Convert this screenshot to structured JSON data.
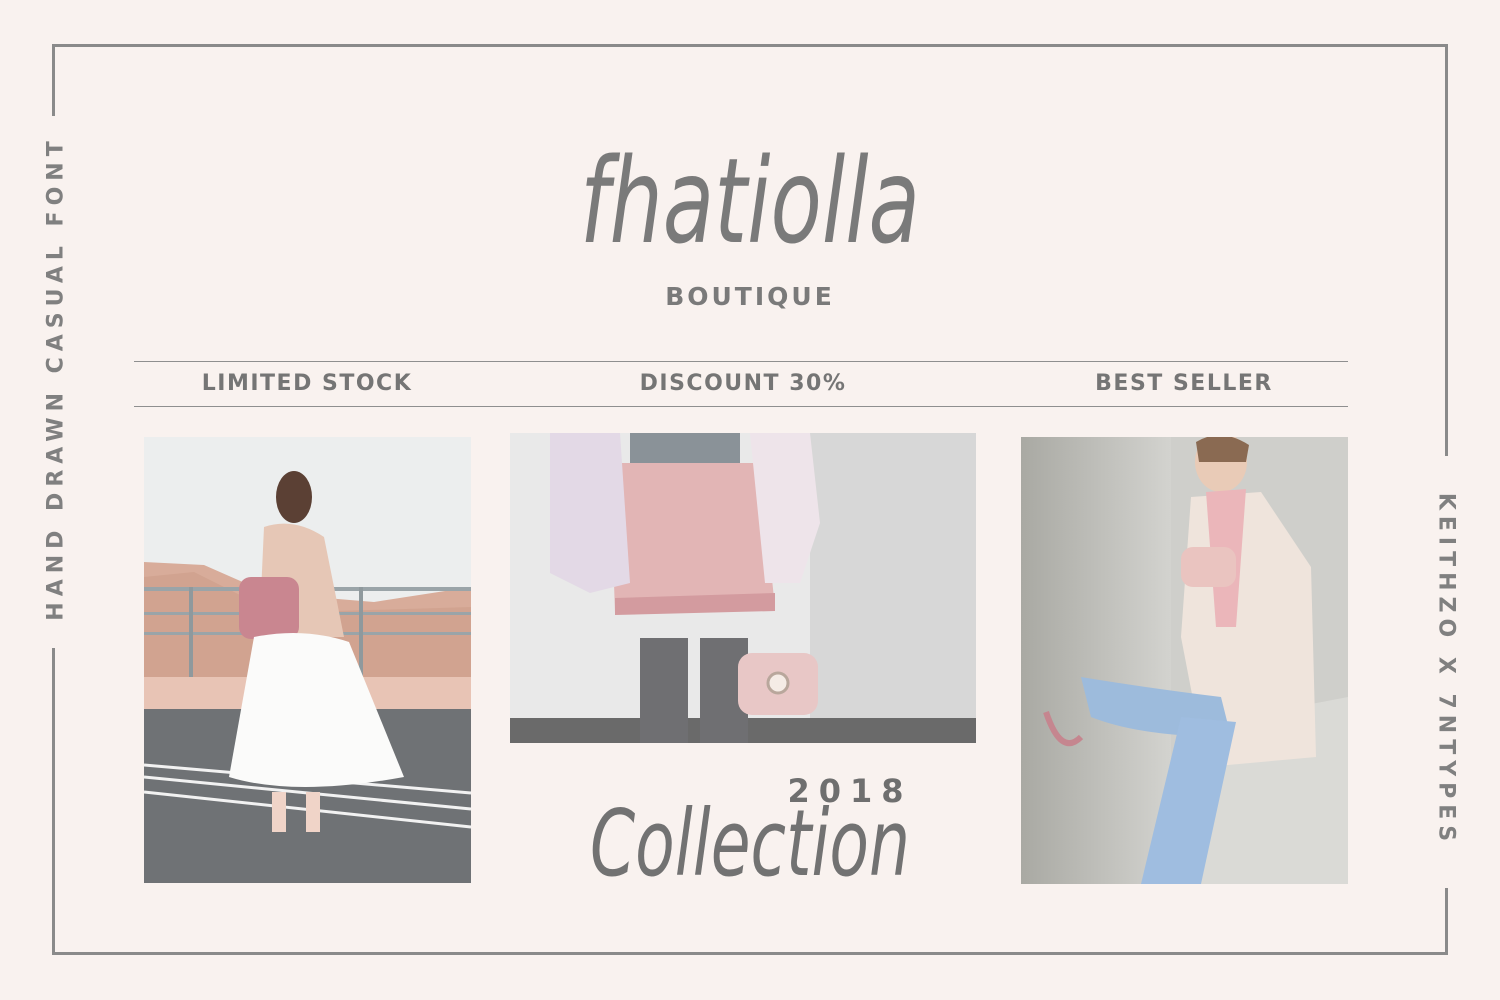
{
  "brand": {
    "name": "fhatiolla",
    "subtitle": "BOUTIQUE"
  },
  "side_labels": {
    "left": "HAND DRAWN CASUAL FONT",
    "right": "KEITHZO X 7NTYPES"
  },
  "tags": [
    "LIMITED STOCK",
    "DISCOUNT 30%",
    "BEST SELLER"
  ],
  "collection": {
    "year": "2018",
    "title": "Collection"
  },
  "colors": {
    "background": "#f9f2ef",
    "text": "#777777",
    "accent_pink": "#d99aa6"
  }
}
